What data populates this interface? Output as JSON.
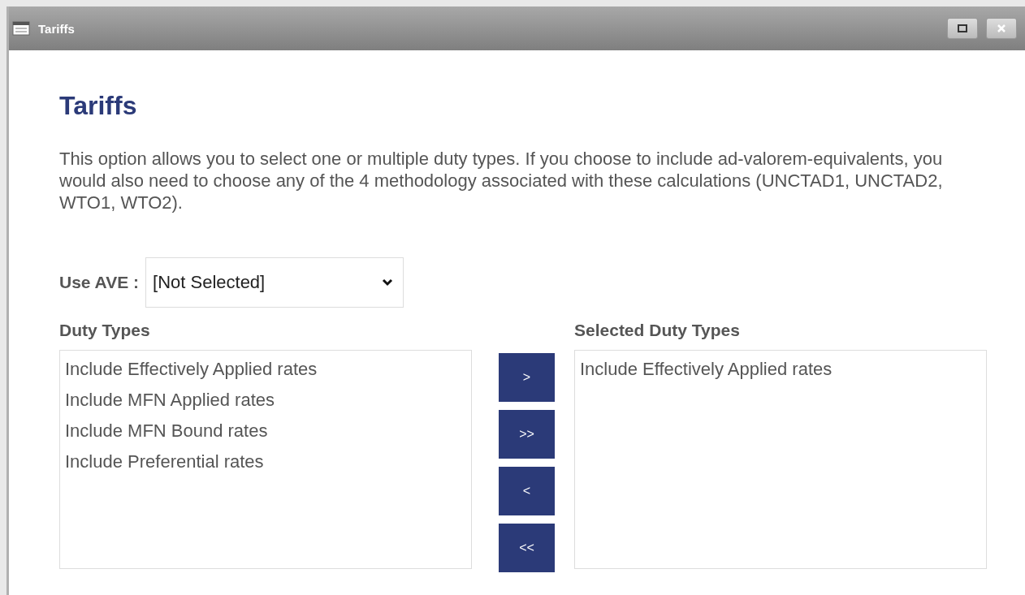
{
  "window": {
    "title": "Tariffs"
  },
  "heading": "Tariffs",
  "description": "This option allows you to select one or multiple duty types. If you choose to include ad-valorem-equivalents, you would also need to choose any of the 4 methodology associated with these calculations (UNCTAD1, UNCTAD2, WTO1, WTO2).",
  "use_ave": {
    "label": "Use AVE :",
    "value": "[Not Selected]"
  },
  "duty_types": {
    "label": "Duty Types",
    "items": [
      "Include Effectively Applied rates",
      "Include MFN Applied rates",
      "Include MFN Bound rates",
      "Include Preferential rates"
    ]
  },
  "move_buttons": [
    ">",
    ">>",
    "<",
    "<<"
  ],
  "selected_duty_types": {
    "label": "Selected Duty Types",
    "items": [
      "Include Effectively Applied rates"
    ]
  }
}
